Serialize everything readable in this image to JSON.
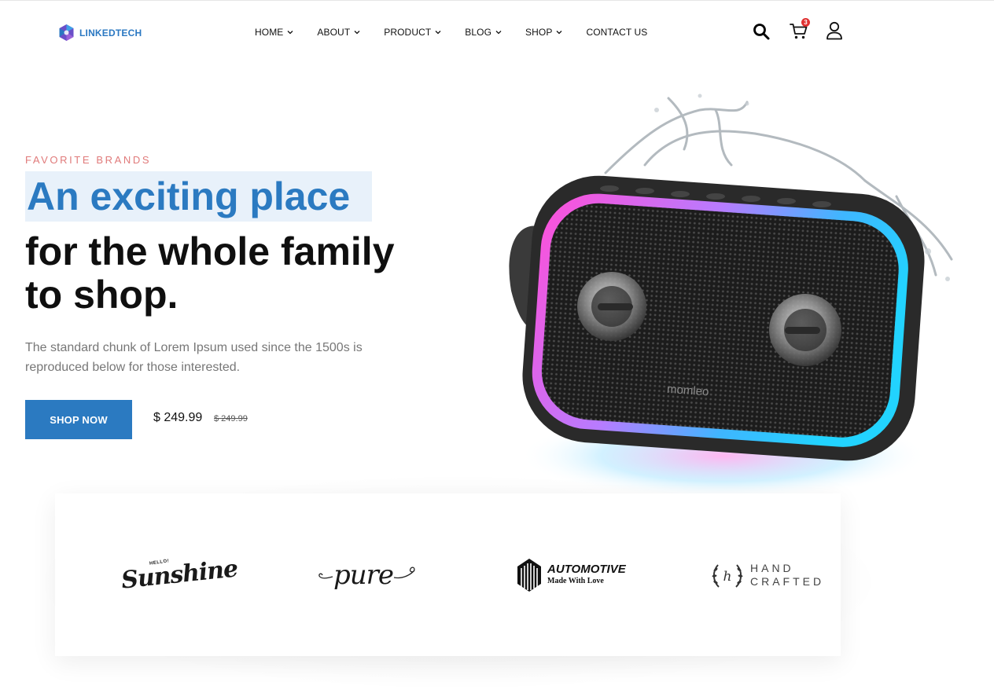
{
  "header": {
    "logo_text": "LINKEDTECH",
    "nav": [
      {
        "label": "HOME",
        "has_dropdown": true
      },
      {
        "label": "ABOUT",
        "has_dropdown": true
      },
      {
        "label": "PRODUCT",
        "has_dropdown": true
      },
      {
        "label": "BLOG",
        "has_dropdown": true
      },
      {
        "label": "SHOP",
        "has_dropdown": true
      },
      {
        "label": "CONTACT US",
        "has_dropdown": false
      }
    ],
    "icons": [
      "search-icon",
      "cart-icon",
      "user-icon"
    ],
    "cart_count": "3"
  },
  "hero": {
    "eyebrow": "FAVORITE BRANDS",
    "title_highlight": "An exciting place",
    "title_line2": "for the whole family",
    "title_line3": "to shop.",
    "description": "The standard chunk of Lorem Ipsum used since the 1500s is reproduced below for those interested.",
    "cta_label": "SHOP NOW",
    "price": "$ 249.99",
    "old_price": "$ 249.99",
    "product_brand": "momleo"
  },
  "brands": {
    "sunshine": {
      "small": "HELLO!",
      "name": "Sunshine"
    },
    "pure": {
      "name": "pure"
    },
    "automotive": {
      "name": "AUTOMOTIVE",
      "tagline": "Made With Love"
    },
    "handcrafted": {
      "line1": "HAND",
      "line2": "CRAFTED",
      "monogram": "h"
    }
  },
  "colors": {
    "accent": "#2b7ac1",
    "eyebrow": "#e07a7a",
    "badge": "#e03131",
    "highlight_bg": "#e8f1fa"
  }
}
